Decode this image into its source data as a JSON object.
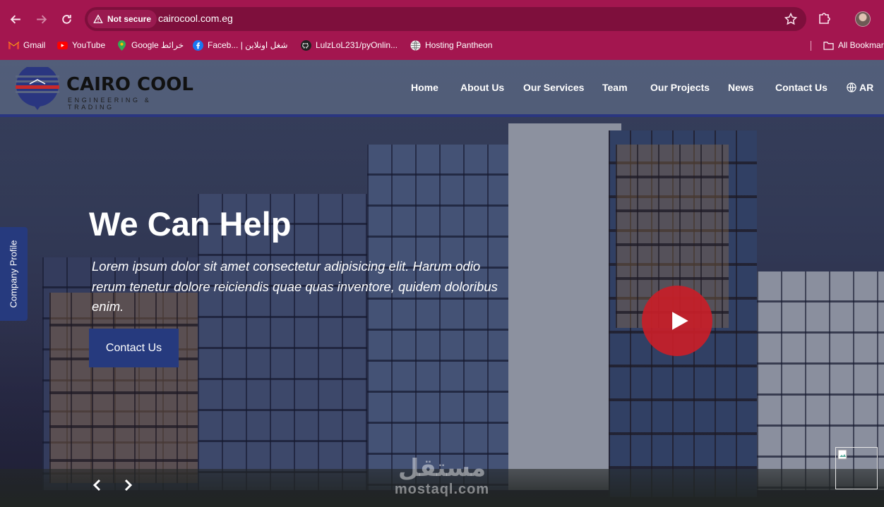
{
  "browser": {
    "security_label": "Not secure",
    "url": "cairocool.com.eg",
    "bookmarks": [
      {
        "label": "Gmail",
        "icon": "gmail-icon"
      },
      {
        "label": "YouTube",
        "icon": "youtube-icon"
      },
      {
        "label": "Google خرائط",
        "icon": "google-maps-icon"
      },
      {
        "label": "Faceb... | شغل اونلاين",
        "icon": "facebook-icon"
      },
      {
        "label": "LulzLoL231/pyOnlin...",
        "icon": "github-icon"
      },
      {
        "label": "Hosting Pantheon",
        "icon": "globe-icon"
      },
      {
        "label": "All Bookmar",
        "icon": "folder-icon"
      }
    ],
    "colors": {
      "frame": "#a3164f",
      "omnibox": "#7e0f3c"
    }
  },
  "site": {
    "logo": {
      "name": "CAIRO COOL",
      "tagline": "ENGINEERING & TRADING"
    },
    "nav": [
      {
        "label": "Home"
      },
      {
        "label": "About Us"
      },
      {
        "label": "Our Services"
      },
      {
        "label": "Team"
      },
      {
        "label": "Our Projects"
      },
      {
        "label": "News"
      },
      {
        "label": "Contact Us"
      }
    ],
    "language_label": "AR",
    "hero": {
      "title": "We Can Help",
      "text": "Lorem ipsum dolor sit amet consectetur adipisicing elit. Harum odio rerum tenetur dolore reiciendis quae quas inventore, quidem doloribus enim.",
      "cta_label": "Contact Us"
    },
    "side_tab_label": "Company Profile",
    "watermark": {
      "arabic": "مستقل",
      "latin": "mostaql.com"
    },
    "colors": {
      "brand_blue": "#263a7e",
      "play_red": "#c81e28"
    }
  }
}
